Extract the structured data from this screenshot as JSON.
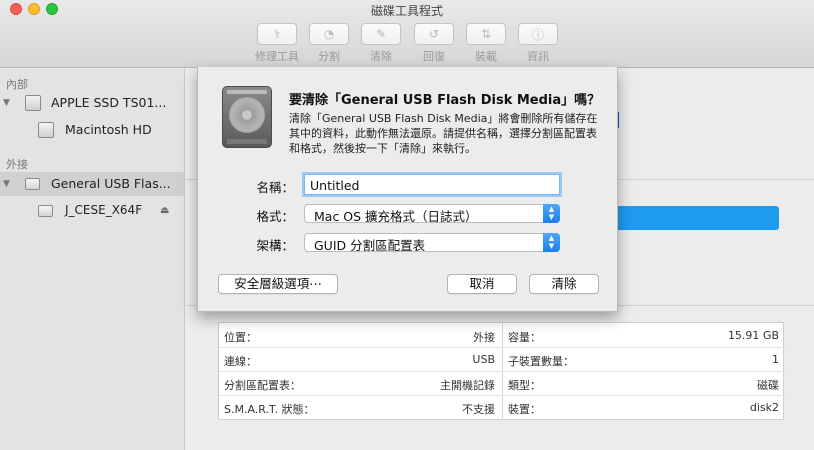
{
  "window": {
    "title": "磁碟工具程式"
  },
  "toolbar": {
    "items": [
      {
        "label": "修理工具",
        "icon": "stethoscope-icon",
        "glyph": "⚕"
      },
      {
        "label": "分割",
        "icon": "pie-chart-icon",
        "glyph": "◔"
      },
      {
        "label": "清除",
        "icon": "erase-icon",
        "glyph": "✎"
      },
      {
        "label": "回復",
        "icon": "restore-icon",
        "glyph": "↺"
      },
      {
        "label": "裝載",
        "icon": "mount-icon",
        "glyph": "⇅"
      },
      {
        "label": "資訊",
        "icon": "info-icon",
        "glyph": "ⓘ"
      }
    ]
  },
  "sidebar": {
    "internal_label": "內部",
    "external_label": "外接",
    "internal_disk": "APPLE SSD TS01...",
    "internal_volume": "Macintosh HD",
    "external_disk": "General USB Flas...",
    "external_volume": "J_CESE_X64F",
    "eject_glyph": "⏏"
  },
  "dialog": {
    "title": "要清除「General USB Flash Disk Media」嗎？",
    "message": "清除「General USB Flash Disk Media」將會刪除所有儲存在其中的資料，此動作無法還原。請提供名稱，選擇分割區配置表和格式，然後按一下「清除」來執行。",
    "name_label": "名稱：",
    "name_value": "Untitled",
    "format_label": "格式：",
    "format_value": "Mac OS 擴充格式（日誌式）",
    "scheme_label": "架構：",
    "scheme_value": "GUID 分割區配置表",
    "security_button": "安全層級選項⋯",
    "cancel_button": "取消",
    "erase_button": "清除"
  },
  "info": {
    "rows": [
      {
        "left_label": "位置：",
        "left_value": "外接",
        "right_label": "容量：",
        "right_value": "15.91 GB"
      },
      {
        "left_label": "連線：",
        "left_value": "USB",
        "right_label": "子裝置數量：",
        "right_value": "1"
      },
      {
        "left_label": "分割區配置表：",
        "left_value": "主開機記錄",
        "right_label": "類型：",
        "right_value": "磁碟"
      },
      {
        "left_label": "S.M.A.R.T. 狀態：",
        "left_value": "不支援",
        "right_label": "裝置：",
        "right_value": "disk2"
      }
    ]
  },
  "colors": {
    "accent": "#1f9cf0",
    "selection": "#d0d0d0"
  }
}
